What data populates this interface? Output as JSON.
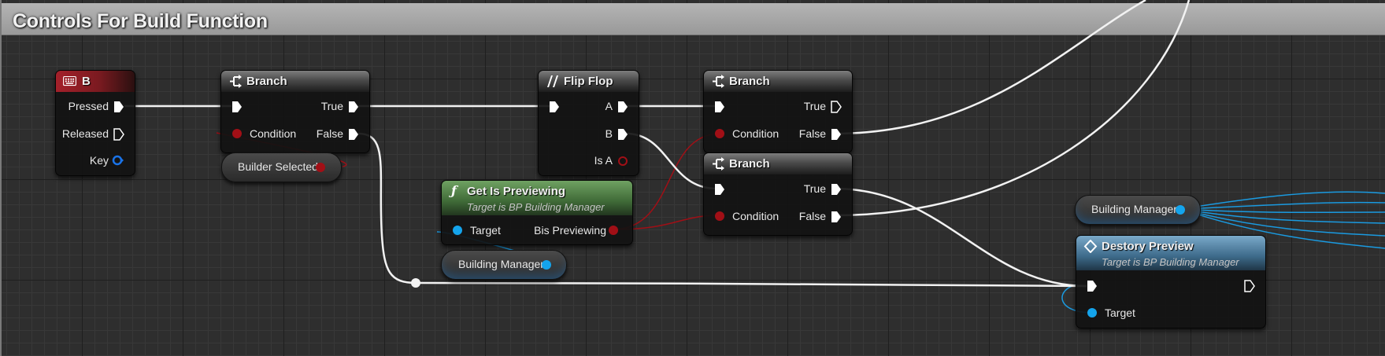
{
  "comment": {
    "title": "Controls For Build Function"
  },
  "nodes": {
    "key_b": {
      "title": "B",
      "pins": {
        "pressed": "Pressed",
        "released": "Released",
        "key": "Key"
      }
    },
    "branch1": {
      "title": "Branch",
      "pins": {
        "condition": "Condition",
        "true": "True",
        "false": "False"
      }
    },
    "builder_selected": {
      "label": "Builder Selected"
    },
    "flip_flop": {
      "title": "Flip Flop",
      "pins": {
        "a": "A",
        "b": "B",
        "is_a": "Is A"
      }
    },
    "get_is_previewing": {
      "title": "Get Is Previewing",
      "subtitle": "Target is BP Building Manager",
      "pins": {
        "target": "Target",
        "output": "Bis Previewing"
      }
    },
    "building_manager_1": {
      "label": "Building Manager"
    },
    "branch2": {
      "title": "Branch",
      "pins": {
        "condition": "Condition",
        "true": "True",
        "false": "False"
      }
    },
    "branch3": {
      "title": "Branch",
      "pins": {
        "condition": "Condition",
        "true": "True",
        "false": "False"
      }
    },
    "building_manager_2": {
      "label": "Building Manager"
    },
    "destroy_preview": {
      "title": "Destory Preview",
      "subtitle": "Target is BP Building Manager",
      "pins": {
        "target": "Target"
      }
    }
  },
  "colors": {
    "exec_wire": "#ffffff",
    "bool_pin": "#a10f16",
    "object_pin": "#14a4ec"
  }
}
